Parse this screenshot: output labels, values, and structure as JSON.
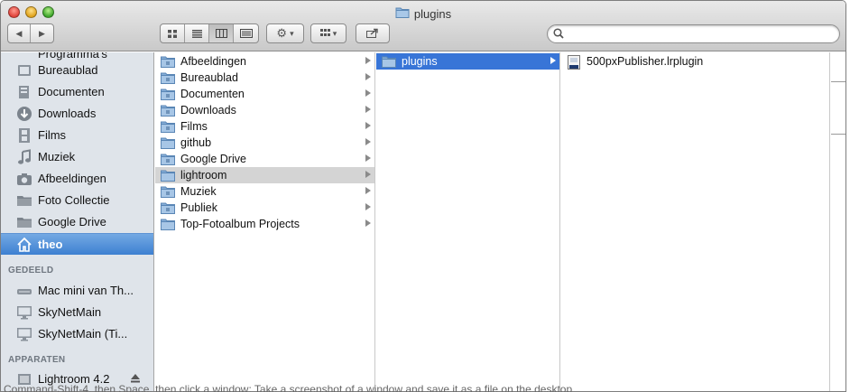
{
  "window": {
    "title": "plugins",
    "title_icon": "folder-icon"
  },
  "toolbar": {
    "back_icon": "back-arrow-icon",
    "forward_icon": "forward-arrow-icon",
    "views": [
      {
        "name": "icon-view",
        "icon": "icon-grid-icon",
        "active": false
      },
      {
        "name": "list-view",
        "icon": "list-icon",
        "active": false
      },
      {
        "name": "column-view",
        "icon": "columns-icon",
        "active": true
      },
      {
        "name": "coverflow-view",
        "icon": "coverflow-icon",
        "active": false
      }
    ],
    "action_icon": "gear-icon",
    "arrange_icon": "arrange-grid-icon",
    "share_icon": "share-icon",
    "search_placeholder": "",
    "search_value": ""
  },
  "sidebar": {
    "partial_top_item": "Programma's",
    "favorites": [
      {
        "label": "Bureaublad",
        "icon": "desktop-icon"
      },
      {
        "label": "Documenten",
        "icon": "documents-icon"
      },
      {
        "label": "Downloads",
        "icon": "downloads-icon"
      },
      {
        "label": "Films",
        "icon": "film-icon"
      },
      {
        "label": "Muziek",
        "icon": "music-icon"
      },
      {
        "label": "Afbeeldingen",
        "icon": "camera-icon"
      },
      {
        "label": "Foto Collectie",
        "icon": "folder-icon"
      },
      {
        "label": "Google Drive",
        "icon": "folder-icon"
      },
      {
        "label": "theo",
        "icon": "home-icon",
        "selected": true
      }
    ],
    "shared_header": "GEDEELD",
    "shared": [
      {
        "label": "Mac mini van Th...",
        "icon": "mac-mini-icon"
      },
      {
        "label": "SkyNetMain",
        "icon": "monitor-icon"
      },
      {
        "label": "SkyNetMain (Ti...",
        "icon": "monitor-icon"
      }
    ],
    "devices_header": "APPARATEN",
    "devices": [
      {
        "label": "Lightroom 4.2",
        "icon": "disk-icon",
        "eject_icon": "eject-icon"
      }
    ]
  },
  "columns": [
    {
      "items": [
        {
          "label": "Afbeeldingen",
          "icon": "pictures-folder-icon"
        },
        {
          "label": "Bureaublad",
          "icon": "desktop-folder-icon"
        },
        {
          "label": "Documenten",
          "icon": "documents-folder-icon"
        },
        {
          "label": "Downloads",
          "icon": "downloads-folder-icon"
        },
        {
          "label": "Films",
          "icon": "movies-folder-icon"
        },
        {
          "label": "github",
          "icon": "folder-icon"
        },
        {
          "label": "Google Drive",
          "icon": "drive-folder-icon"
        },
        {
          "label": "lightroom",
          "icon": "folder-icon",
          "selected": "inactive"
        },
        {
          "label": "Muziek",
          "icon": "music-folder-icon"
        },
        {
          "label": "Publiek",
          "icon": "public-folder-icon"
        },
        {
          "label": "Top-Fotoalbum Projects",
          "icon": "folder-icon"
        }
      ]
    },
    {
      "items": [
        {
          "label": "plugins",
          "icon": "folder-icon",
          "selected": "active"
        }
      ]
    },
    {
      "items": [
        {
          "label": "500pxPublisher.lrplugin",
          "icon": "plugin-file-icon"
        }
      ]
    }
  ],
  "background_text": "Command-Shift-4, then Space, then click a window: Take a screenshot of a window and save it as a file on the desktop",
  "colors": {
    "sidebar_bg": "#dfe4ea",
    "selection_blue": "#3875d7",
    "selection_gray": "#d4d4d4"
  }
}
